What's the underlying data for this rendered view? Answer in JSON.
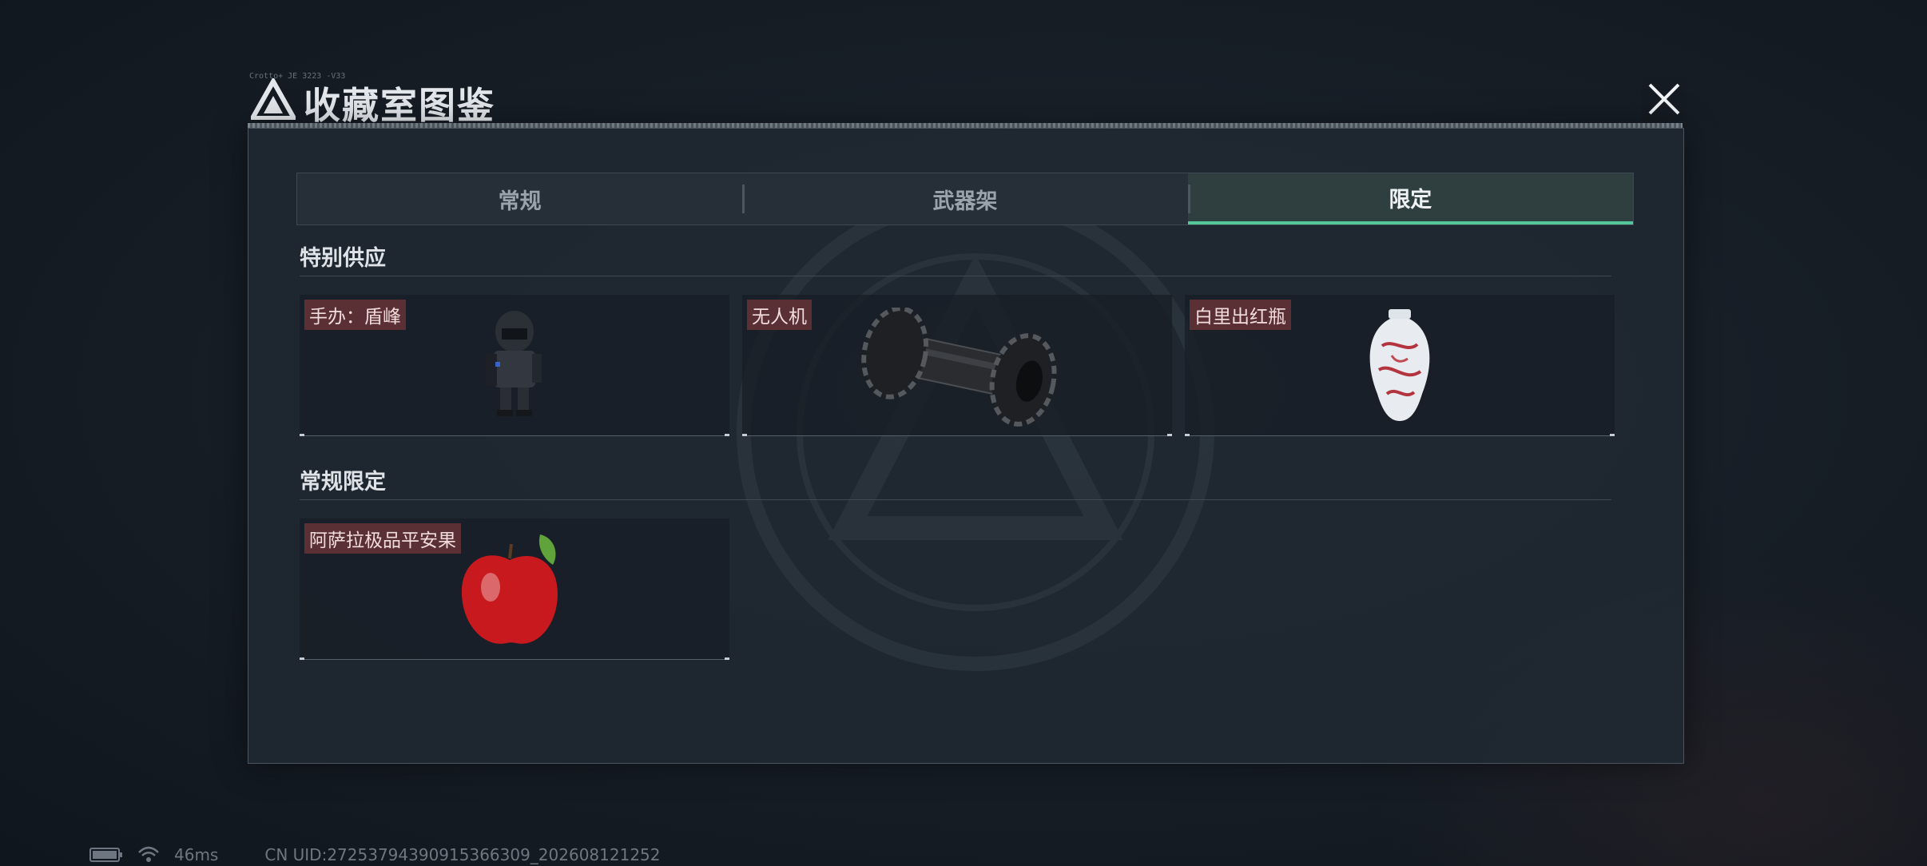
{
  "dialog": {
    "title": "收藏室图鉴",
    "title_small": "Crotto+ JE 3223 -V33"
  },
  "tabs": [
    {
      "label": "常规",
      "active": false
    },
    {
      "label": "武器架",
      "active": false
    },
    {
      "label": "限定",
      "active": true
    }
  ],
  "sections": [
    {
      "title": "特别供应",
      "items": [
        {
          "label": "手办：盾峰",
          "icon": "figure-icon"
        },
        {
          "label": "无人机",
          "icon": "drone-roller-icon"
        },
        {
          "label": "白里出红瓶",
          "icon": "porcelain-vase-icon"
        }
      ]
    },
    {
      "title": "常规限定",
      "items": [
        {
          "label": "阿萨拉极品平安果",
          "icon": "apple-icon"
        }
      ]
    }
  ],
  "status": {
    "ping": "46ms",
    "uid": "CN UID:27253794390915366309_202608121252"
  },
  "colors": {
    "accent": "#53c79a",
    "label_bg": "#5b3035"
  }
}
